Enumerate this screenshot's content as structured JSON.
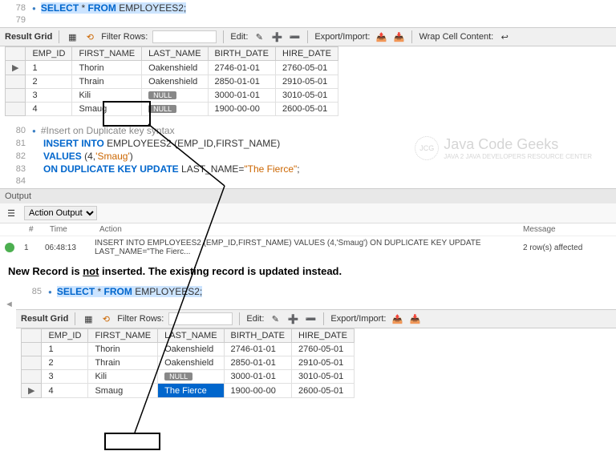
{
  "code1": {
    "line78": {
      "num": "78",
      "kw1": "SELECT",
      "op": "*",
      "kw2": "FROM",
      "ident": "EMPLOYEES2",
      "semi": ";"
    },
    "line79": {
      "num": "79"
    }
  },
  "toolbar1": {
    "result_grid": "Result Grid",
    "filter_rows": "Filter Rows:",
    "filter_value": "",
    "edit": "Edit:",
    "export_import": "Export/Import:",
    "wrap_cell": "Wrap Cell Content:"
  },
  "table1": {
    "headers": [
      "EMP_ID",
      "FIRST_NAME",
      "LAST_NAME",
      "BIRTH_DATE",
      "HIRE_DATE"
    ],
    "rows": [
      {
        "marker": "▶",
        "cells": [
          "1",
          "Thorin",
          "Oakenshield",
          "2746-01-01",
          "2760-05-01"
        ]
      },
      {
        "marker": "",
        "cells": [
          "2",
          "Thrain",
          "Oakenshield",
          "2850-01-01",
          "2910-05-01"
        ]
      },
      {
        "marker": "",
        "cells": [
          "3",
          "Kili",
          "NULL",
          "3000-01-01",
          "3010-05-01"
        ]
      },
      {
        "marker": "",
        "cells": [
          "4",
          "Smaug",
          "NULL",
          "1900-00-00",
          "2600-05-01"
        ]
      }
    ]
  },
  "code2": {
    "line80": {
      "num": "80",
      "comment": "#Insert on Duplicate key syntax"
    },
    "line81": {
      "num": "81",
      "kw1": "INSERT INTO",
      "ident": "EMPLOYEES2",
      "cols": "(EMP_ID,FIRST_NAME)"
    },
    "line82": {
      "num": "82",
      "kw1": "VALUES",
      "vals": "(4,",
      "str": "'Smaug'",
      "close": ")"
    },
    "line83": {
      "num": "83",
      "kw1": "ON DUPLICATE KEY UPDATE",
      "ident": "LAST_NAME=",
      "str": "\"The Fierce\"",
      "semi": ";"
    },
    "line84": {
      "num": "84"
    }
  },
  "output": {
    "title": "Output",
    "dropdown": "Action Output",
    "col_hash": "#",
    "col_time": "Time",
    "col_action": "Action",
    "col_message": "Message",
    "row1": {
      "num": "1",
      "time": "06:48:13",
      "action": "INSERT INTO EMPLOYEES2 (EMP_ID,FIRST_NAME) VALUES (4,'Smaug') ON DUPLICATE KEY UPDATE LAST_NAME=\"The Fierc...",
      "message": "2 row(s) affected"
    }
  },
  "annotation": {
    "text_pre": "New Record is ",
    "text_not": "not",
    "text_post": " inserted. The existing record is updated instead."
  },
  "code3": {
    "line85": {
      "num": "85",
      "kw1": "SELECT",
      "op": "*",
      "kw2": "FROM",
      "ident": "EMPLOYEES2",
      "semi": ";"
    }
  },
  "toolbar2": {
    "result_grid": "Result Grid",
    "filter_rows": "Filter Rows:",
    "filter_value": "",
    "edit": "Edit:",
    "export_import": "Export/Import:"
  },
  "table2": {
    "headers": [
      "EMP_ID",
      "FIRST_NAME",
      "LAST_NAME",
      "BIRTH_DATE",
      "HIRE_DATE"
    ],
    "rows": [
      {
        "marker": "",
        "cells": [
          "1",
          "Thorin",
          "Oakenshield",
          "2746-01-01",
          "2760-05-01"
        ]
      },
      {
        "marker": "",
        "cells": [
          "2",
          "Thrain",
          "Oakenshield",
          "2850-01-01",
          "2910-05-01"
        ]
      },
      {
        "marker": "",
        "cells": [
          "3",
          "Kili",
          "NULL",
          "3000-01-01",
          "3010-05-01"
        ]
      },
      {
        "marker": "▶",
        "cells": [
          "4",
          "Smaug",
          "The Fierce",
          "1900-00-00",
          "2600-05-01"
        ],
        "selected_col": 2
      }
    ]
  },
  "watermark": {
    "main": "Java Code Geeks",
    "sub": "JAVA 2 JAVA DEVELOPERS RESOURCE CENTER"
  }
}
